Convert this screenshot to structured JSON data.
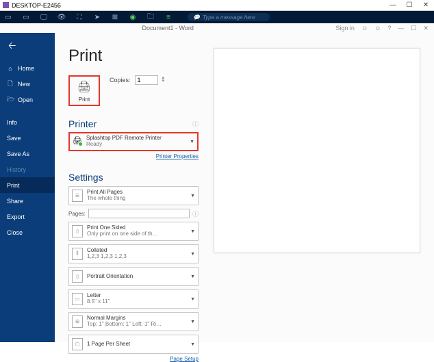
{
  "chrome": {
    "title": "DESKTOP-E2456"
  },
  "toolbar": {
    "message_placeholder": "Type a message here"
  },
  "word_header": {
    "title": "Document1 - Word",
    "signin": "Sign in"
  },
  "sidebar": {
    "items": [
      {
        "icon": "⌂",
        "label": "Home"
      },
      {
        "icon": "🗋",
        "label": "New"
      },
      {
        "icon": "🗁",
        "label": "Open"
      }
    ],
    "items2": [
      {
        "label": "Info"
      },
      {
        "label": "Save"
      },
      {
        "label": "Save As"
      },
      {
        "label": "History"
      },
      {
        "label": "Print"
      },
      {
        "label": "Share"
      },
      {
        "label": "Export"
      },
      {
        "label": "Close"
      }
    ]
  },
  "print": {
    "heading": "Print",
    "button_label": "Print",
    "copies_label": "Copies:",
    "copies_value": "1"
  },
  "printer": {
    "heading": "Printer",
    "name": "Splashtop PDF Remote Printer",
    "status": "Ready",
    "properties_link": "Printer Properties"
  },
  "settings": {
    "heading": "Settings",
    "pages_label": "Pages:",
    "page_setup_link": "Page Setup",
    "rows": [
      {
        "title": "Print All Pages",
        "sub": "The whole thing"
      },
      {
        "title": "Print One Sided",
        "sub": "Only print on one side of th…"
      },
      {
        "title": "Collated",
        "sub": "1,2,3   1,2,3   1,2,3"
      },
      {
        "title": "Portrait Orientation",
        "sub": ""
      },
      {
        "title": "Letter",
        "sub": "8.5\" x 11\""
      },
      {
        "title": "Normal Margins",
        "sub": "Top: 1\" Bottom: 1\" Left: 1\" Ri…"
      },
      {
        "title": "1 Page Per Sheet",
        "sub": ""
      }
    ]
  }
}
